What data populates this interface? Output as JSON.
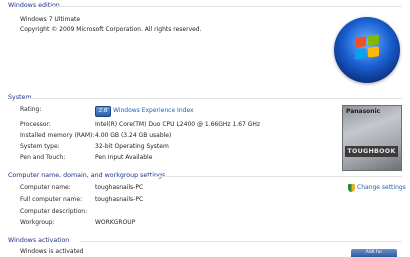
{
  "windows_edition": {
    "title": "Windows edition",
    "edition": "Windows 7 Ultimate",
    "copyright": "Copyright © 2009 Microsoft Corporation.  All rights reserved."
  },
  "system": {
    "title": "System",
    "rating_label": "Rating:",
    "rating_score": "2.8",
    "rating_link": "Windows Experience Index",
    "processor_label": "Processor:",
    "processor_value": "Intel(R) Core(TM) Duo CPU      L2400  @ 1.66GHz   1.67 GHz",
    "memory_label": "Installed memory (RAM):",
    "memory_value": "4.00 GB (3.24 GB usable)",
    "system_type_label": "System type:",
    "system_type_value": "32-bit Operating System",
    "pen_label": "Pen and Touch:",
    "pen_value": "Pen Input Available",
    "oem_brand": "Panasonic",
    "oem_name": "TOUGHBOOK"
  },
  "computer": {
    "title": "Computer name, domain, and workgroup settings",
    "change_settings": "Change settings",
    "computer_name_label": "Computer name:",
    "computer_name_value": "toughasnails-PC",
    "full_name_label": "Full computer name:",
    "full_name_value": "toughasnails-PC",
    "description_label": "Computer description:",
    "description_value": "",
    "workgroup_label": "Workgroup:",
    "workgroup_value": "WORKGROUP"
  },
  "activation": {
    "title": "Windows activation",
    "status": "Windows is activated",
    "genuine_button": "ASK for"
  },
  "colors": {
    "section_title": "#1e3287",
    "link": "#1f5fb5",
    "rule": "#e3e3e3"
  }
}
